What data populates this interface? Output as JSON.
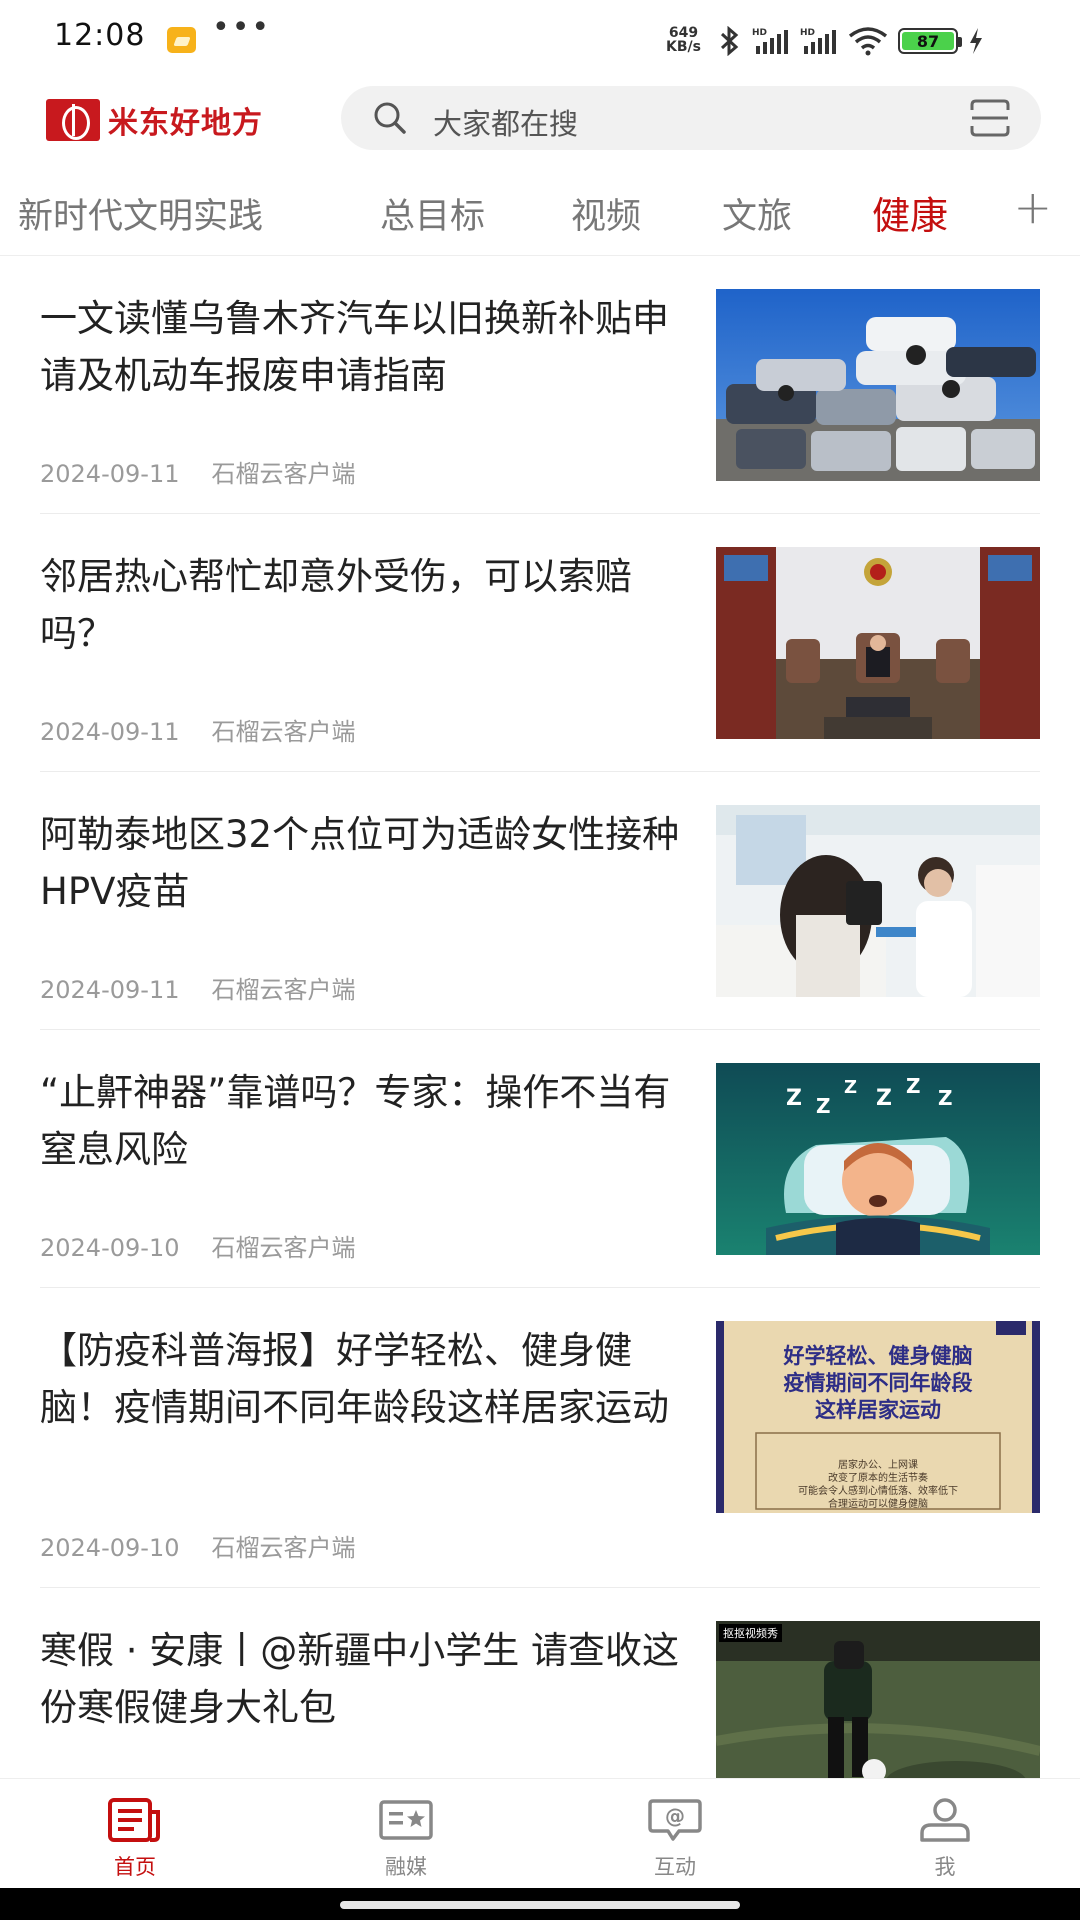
{
  "status_bar": {
    "time": "12:08",
    "dots": "•••",
    "speed_value": "649",
    "speed_unit": "KB/s",
    "battery": "87",
    "icons": [
      "bluetooth-icon",
      "hd-signal-icon",
      "hd-signal-icon",
      "wifi-icon",
      "battery-icon",
      "charging-icon"
    ]
  },
  "header": {
    "logo_text": "米东好地方",
    "search_placeholder": "大家都在搜"
  },
  "tabs": [
    "新时代文明实践",
    "总目标",
    "视频",
    "文旅",
    "健康"
  ],
  "active_tab": "健康",
  "tab_add": "+",
  "articles": [
    {
      "title": "一文读懂乌鲁木齐汽车以旧换新补贴申请及机动车报废申请指南",
      "date": "2024-09-11",
      "source": "石榴云客户端",
      "image": "scrapyard-cars-photo"
    },
    {
      "title": "邻居热心帮忙却意外受伤，可以索赔吗？",
      "date": "2024-09-11",
      "source": "石榴云客户端",
      "image": "courtroom-photo"
    },
    {
      "title": "阿勒泰地区32个点位可为适龄女性接种HPV疫苗",
      "date": "2024-09-11",
      "source": "石榴云客户端",
      "image": "vaccination-photo"
    },
    {
      "title": "“止鼾神器”靠谱吗？专家：操作不当有窒息风险",
      "date": "2024-09-10",
      "source": "石榴云客户端",
      "image": "snoring-illustration"
    },
    {
      "title": "【防疫科普海报】好学轻松、健身健脑！疫情期间不同年龄段这样居家运动",
      "date": "2024-09-10",
      "source": "石榴云客户端",
      "image": "poster-image",
      "poster": {
        "headline": [
          "好学轻松、健身健脑",
          "疫情期间不同年龄段",
          "这样居家运动"
        ],
        "body": [
          "居家办公、上网课",
          "改变了原本的生活节奏",
          "可能会令人感到心情低落、效率低下",
          "合理运动可以健身健脑"
        ]
      }
    },
    {
      "title": "寒假 · 安康丨@新疆中小学生 请查收这份寒假健身大礼包",
      "date": "",
      "source": "",
      "image": "football-video-still",
      "video_tag": "抠抠视频秀"
    }
  ],
  "bottom_nav": [
    {
      "label": "首页",
      "icon": "news-icon",
      "active": true
    },
    {
      "label": "融媒",
      "icon": "media-card-icon",
      "active": false
    },
    {
      "label": "互动",
      "icon": "chat-at-icon",
      "active": false
    },
    {
      "label": "我",
      "icon": "user-icon",
      "active": false
    }
  ],
  "colors": {
    "brand_red": "#c8191e",
    "active_red": "#c40f0f",
    "text": "#222222",
    "meta": "#9a9a9a"
  }
}
